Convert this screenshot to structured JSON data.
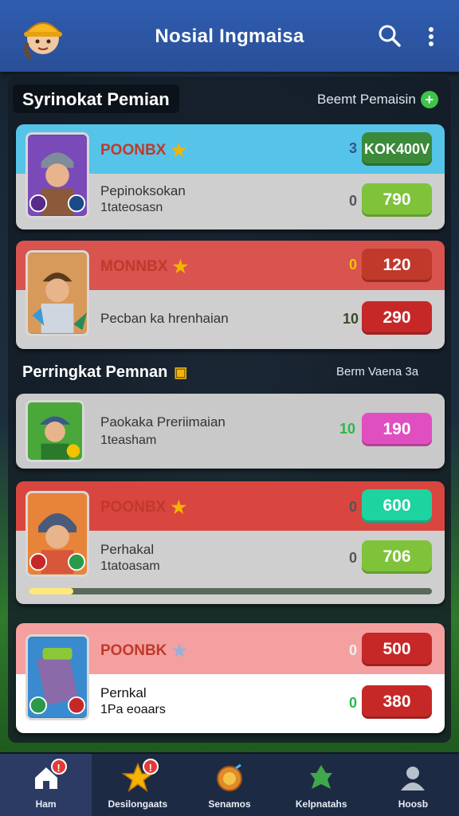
{
  "header": {
    "title": "Nosial Ingmaisa",
    "search_icon": "search-icon",
    "more_icon": "more-vert-icon"
  },
  "section1": {
    "title": "Syrinokat Pemian",
    "action_label": "Beemt Pemaisin"
  },
  "section2": {
    "title": "Perringkat Pemnan",
    "right_label": "Berm Vaena 3a"
  },
  "cards": [
    {
      "name": "POONBX",
      "line1": "Pepinoksokan",
      "line2": "1tateosasn",
      "top_num": "3",
      "top_pill": "KOK400V",
      "bot_num": "0",
      "bot_pill": "790"
    },
    {
      "name": "MONNBX",
      "line1": "Pecban ka hrenhaian",
      "line2": "",
      "top_num": "0",
      "top_pill": "120",
      "bot_num": "10",
      "bot_pill": "290"
    },
    {
      "name": "",
      "line1": "Paokaka Preriimaian",
      "line2": "1teasham",
      "top_num": "",
      "top_pill": "",
      "bot_num": "10",
      "bot_pill": "190"
    },
    {
      "name": "POONBX",
      "line1": "Perhakal",
      "line2": "1tatoasam",
      "top_num": "0",
      "top_pill": "600",
      "bot_num": "0",
      "bot_pill": "706",
      "progress": 0.11
    },
    {
      "name": "POONBK",
      "line1": "Pernkal",
      "line2": "1Pa eoaars",
      "top_num": "0",
      "top_pill": "500",
      "bot_num": "0",
      "bot_pill": "380"
    }
  ],
  "nav": [
    {
      "label": "Ham",
      "icon": "home-icon",
      "badge": "!"
    },
    {
      "label": "Desilongaats",
      "icon": "star-icon",
      "badge": "!"
    },
    {
      "label": "Senamos",
      "icon": "medal-icon",
      "badge": ""
    },
    {
      "label": "Kelpnatahs",
      "icon": "trophy-icon",
      "badge": ""
    },
    {
      "label": "Hoosb",
      "icon": "profile-icon",
      "badge": ""
    }
  ],
  "colors": {
    "header": "#2f5db0",
    "green_pill": "#7fc33a",
    "red_pill": "#c62828",
    "pink_pill": "#e04fc0",
    "teal_pill": "#1dd3a0",
    "card1_top": "#55c4e8",
    "card_red_top": "#d9534f",
    "card_gray": "#c9c9c9"
  }
}
